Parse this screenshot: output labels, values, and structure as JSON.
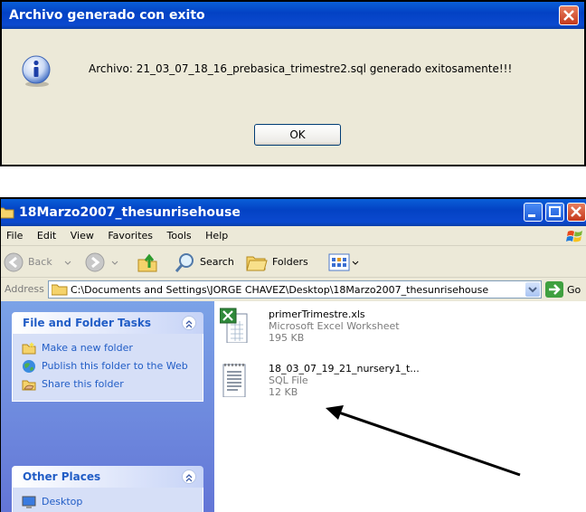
{
  "dialog": {
    "title": "Archivo generado con exito",
    "message": "Archivo: 21_03_07_18_16_prebasica_trimestre2.sql generado exitosamente!!!",
    "ok_label": "OK"
  },
  "explorer": {
    "title": "18Marzo2007_thesunrisehouse",
    "menu": [
      "File",
      "Edit",
      "View",
      "Favorites",
      "Tools",
      "Help"
    ],
    "toolbar": {
      "back": "Back",
      "search": "Search",
      "folders": "Folders"
    },
    "address": {
      "label": "Address",
      "path": "C:\\Documents and Settings\\JORGE CHAVEZ\\Desktop\\18Marzo2007_thesunrisehouse",
      "go": "Go"
    },
    "file_tasks": {
      "title": "File and Folder Tasks",
      "items": [
        "Make a new folder",
        "Publish this folder to the Web",
        "Share this folder"
      ]
    },
    "other_places": {
      "title": "Other Places",
      "items": [
        "Desktop"
      ]
    },
    "files": [
      {
        "name": "primerTrimestre.xls",
        "type": "Microsoft Excel Worksheet",
        "size": "195 KB",
        "icon": "excel-file-icon"
      },
      {
        "name": "18_03_07_19_21_nursery1_t...",
        "type": "SQL File",
        "size": "12 KB",
        "icon": "text-file-icon"
      }
    ]
  },
  "colors": {
    "xp_blue": "#0342c4",
    "task_blue": "#215dc6",
    "pane_gradient": "#7ba2e7"
  }
}
